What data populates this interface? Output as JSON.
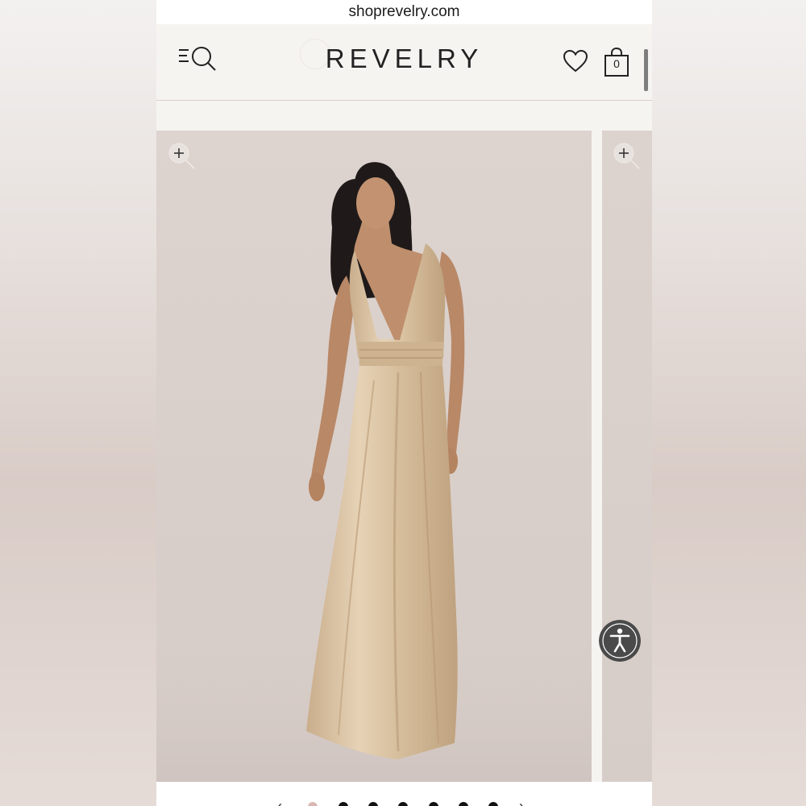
{
  "browser": {
    "url": "shoprevelry.com"
  },
  "header": {
    "logo": "REVELRY",
    "bag_count": "0"
  },
  "gallery": {
    "current_index": 1,
    "total_images": 7,
    "image_description": "model wearing champagne satin halter maxi dress"
  },
  "icons": {
    "menu": "menu-search-icon",
    "wishlist": "heart-icon",
    "bag": "shopping-bag-icon",
    "zoom": "zoom-in-icon",
    "accessibility": "accessibility-icon"
  },
  "colors": {
    "page_bg": "#f6f4f1",
    "photo_bg": "#dcd2ce",
    "dress": "#d9c2a2",
    "accessibility_bg": "#4a4a4a",
    "active_dot": "#d9b8b2"
  }
}
